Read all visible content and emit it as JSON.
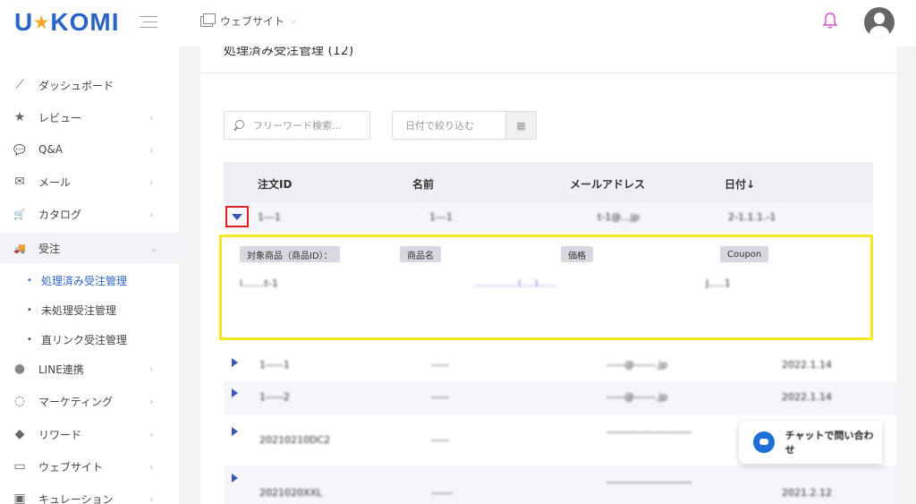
{
  "brand": {
    "logo_left": "U",
    "logo_star": "★",
    "logo_right": "KOMI"
  },
  "header": {
    "site_label": "ウェブサイト",
    "site_chevron": "⌵"
  },
  "sidebar": {
    "items": [
      {
        "label": "ダッシュボード",
        "icon": "chart-icon",
        "glyph": "⟋"
      },
      {
        "label": "レビュー",
        "icon": "star-icon",
        "glyph": "★"
      },
      {
        "label": "Q&A",
        "icon": "chat-bubbles-icon",
        "glyph": "💬"
      },
      {
        "label": "メール",
        "icon": "envelope-icon",
        "glyph": "✉"
      },
      {
        "label": "カタログ",
        "icon": "cart-icon",
        "glyph": "🛒"
      },
      {
        "label": "受注",
        "icon": "truck-icon",
        "glyph": "🚚"
      },
      {
        "label": "LINE連携",
        "icon": "line-icon",
        "glyph": "●"
      },
      {
        "label": "マーケティング",
        "icon": "marketing-icon",
        "glyph": "◌"
      },
      {
        "label": "リワード",
        "icon": "tag-icon",
        "glyph": "◆"
      },
      {
        "label": "ウェブサイト",
        "icon": "window-icon",
        "glyph": "▭"
      },
      {
        "label": "キュレーション",
        "icon": "curation-icon",
        "glyph": "▣"
      }
    ],
    "sub_items": [
      {
        "label": "処理済み受注管理"
      },
      {
        "label": "未処理受注管理"
      },
      {
        "label": "直リンク受注管理"
      }
    ],
    "chevron": "›",
    "chevron_open": "⌄",
    "bullet": "•"
  },
  "main": {
    "title": "処理済み受注管理 (12)",
    "search_placeholder": "フリーワード検索...",
    "date_placeholder": "日付で絞り込む",
    "calendar_icon": "▦",
    "columns": [
      "注文ID",
      "名前",
      "メールアドレス",
      "日付↓"
    ],
    "expanded_row": {
      "id": "1---1",
      "name": "1---1",
      "email": "t-1@...jp",
      "date": "2-1.1.1.-1"
    },
    "detail": {
      "tags": [
        "対象商品（商品ID）：",
        "商品名",
        "価格",
        "Coupon"
      ],
      "values": [
        "l.......t-1",
        "..............(....)......",
        "J.....1"
      ]
    },
    "rows": [
      {
        "id": "1-----1",
        "name": "-----",
        "email": "-----@------.jp",
        "date": "2022.1.14"
      },
      {
        "id": "1-----2",
        "name": "-----",
        "email": "-----@------.jp",
        "date": "2022.1.14"
      },
      {
        "id": "20210210DC2",
        "name": "-----",
        "email": "------------------------",
        "date": ""
      },
      {
        "id": "2021020XXL",
        "name": "------",
        "email": "------------------------",
        "date": "2021.2.12"
      }
    ]
  },
  "chat": {
    "label": "チャットで問い合わせ"
  }
}
